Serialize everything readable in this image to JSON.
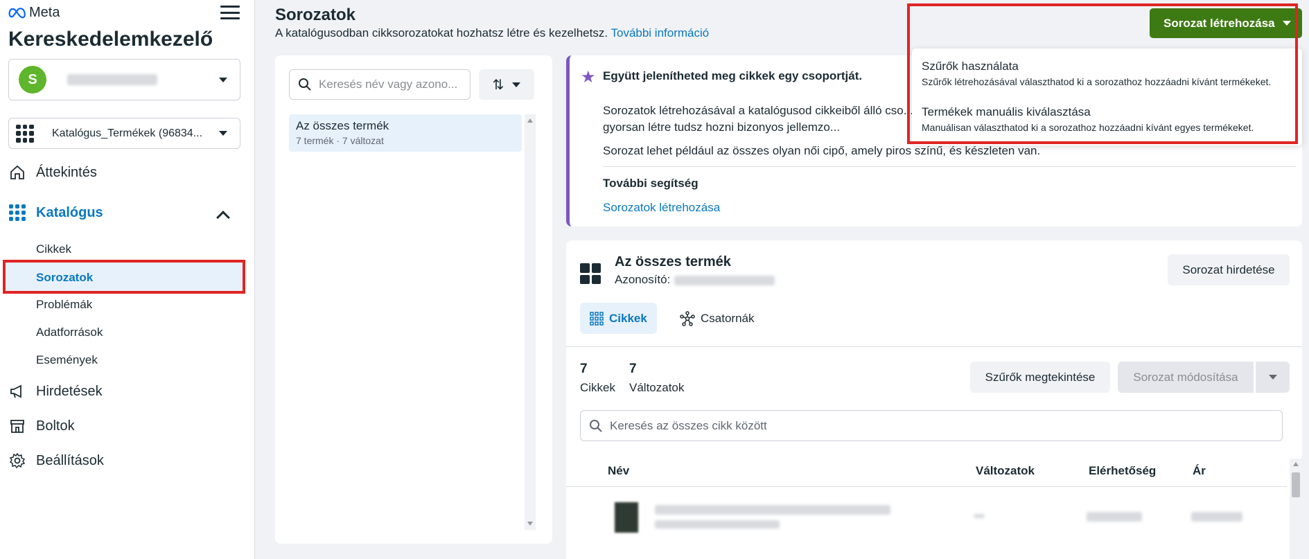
{
  "brand": {
    "logo_text": "Meta",
    "app_title": "Kereskedelemkezelő"
  },
  "account": {
    "avatar_letter": "S"
  },
  "catalog": {
    "label": "Katalógus_Termékek (96834..."
  },
  "nav": {
    "overview": "Áttekintés",
    "catalog": "Katalógus",
    "catalog_sub": [
      "Cikkek",
      "Sorozatok",
      "Problémák",
      "Adatforrások",
      "Események"
    ],
    "ads": "Hirdetések",
    "shops": "Boltok",
    "settings": "Beállítások"
  },
  "header": {
    "title": "Sorozatok",
    "subtitle": "A katalógusodban cikksorozatokat hozhatsz létre és kezelhetsz.",
    "more_link": "További információ"
  },
  "create": {
    "button_label": "Sorozat létrehozása",
    "menu": [
      {
        "title": "Szűrők használata",
        "desc": "Szűrők létrehozásával választhatod ki a sorozathoz hozzáadni kívánt termékeket."
      },
      {
        "title": "Termékek manuális kiválasztása",
        "desc": "Manuálisan választhatod ki a sorozathoz hozzáadni kívánt egyes termékeket."
      }
    ]
  },
  "set_list": {
    "search_placeholder": "Keresés név vagy azono...",
    "sort_icon": "⇅",
    "items": [
      {
        "title": "Az összes termék",
        "meta": "7 termék · 7 változat"
      }
    ]
  },
  "info": {
    "title": "Együtt jelenítheted meg cikkek egy csoportját.",
    "p1": "Sorozatok létrehozásával a katalógusod cikkeiből álló cso... használatával gyorsan létre tudsz hozni bizonyos jellemzo...",
    "p2": "Sorozat lehet például az összes olyan női cipő, amely piros színű, és készleten van.",
    "help_title": "További segítség",
    "help_link": "Sorozatok létrehozása"
  },
  "detail": {
    "title": "Az összes termék",
    "id_label": "Azonosító:",
    "ad_button": "Sorozat hirdetése",
    "tabs": [
      "Cikkek",
      "Csatornák"
    ],
    "stats": [
      {
        "num": "7",
        "label": "Cikkek"
      },
      {
        "num": "7",
        "label": "Változatok"
      }
    ],
    "filter_button": "Szűrők megtekintése",
    "modify_button": "Sorozat módosítása",
    "item_search_placeholder": "Keresés az összes cikk között",
    "columns": [
      "Név",
      "Változatok",
      "Elérhetőség",
      "Ár"
    ]
  },
  "colors": {
    "accent": "#0a78be",
    "primary_button": "#3e7a14",
    "highlight": "#e02424",
    "info_border": "#7e57c2"
  }
}
